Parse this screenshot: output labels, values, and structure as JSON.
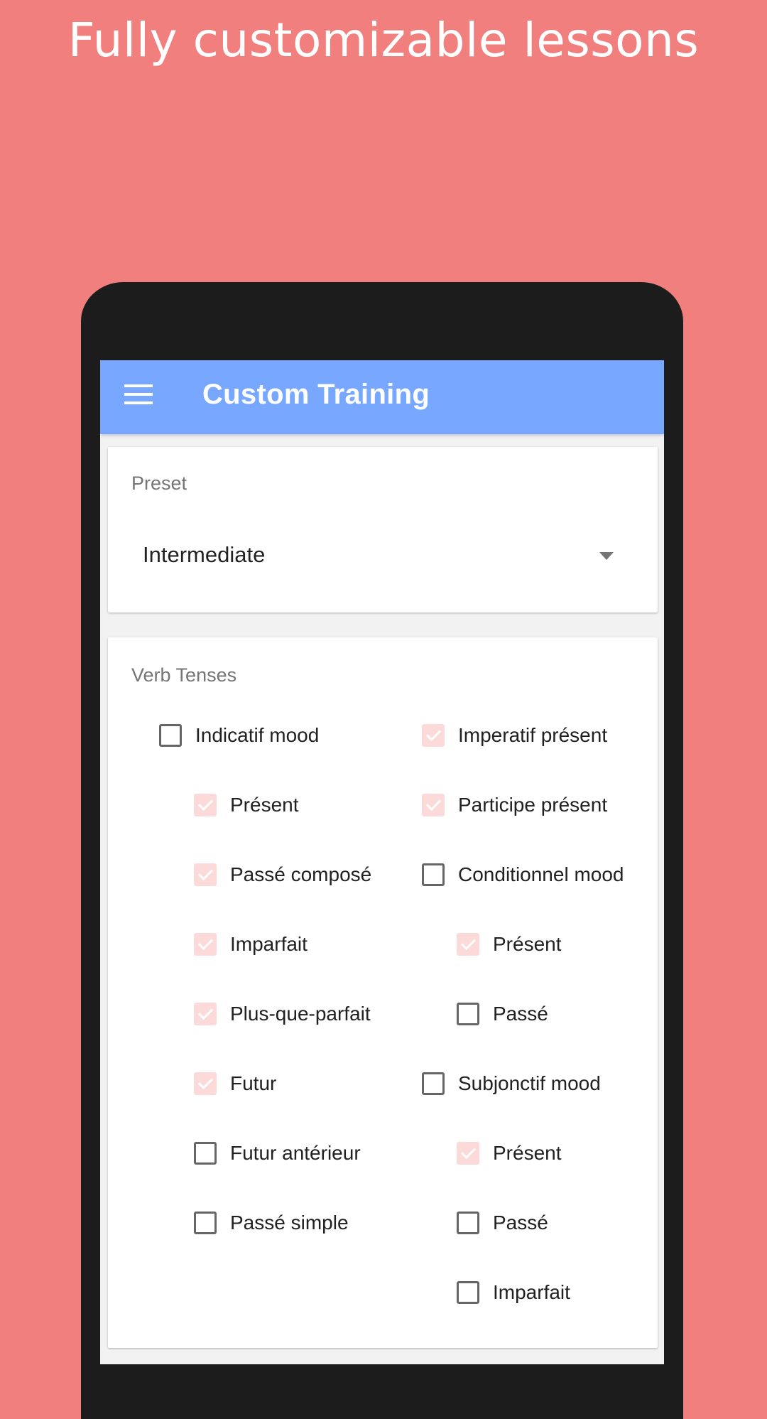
{
  "promo": {
    "title": "Fully customizable lessons"
  },
  "app_bar": {
    "title": "Custom Training",
    "menu_icon": "hamburger-menu-icon"
  },
  "preset": {
    "label": "Preset",
    "selected": "Intermediate",
    "arrow_icon": "dropdown-arrow-icon"
  },
  "tenses": {
    "label": "Verb Tenses",
    "left_column": [
      {
        "label": "Indicatif mood",
        "checked": false
      },
      {
        "label": "Présent",
        "checked": true
      },
      {
        "label": "Passé composé",
        "checked": true
      },
      {
        "label": "Imparfait",
        "checked": true
      },
      {
        "label": "Plus-que-parfait",
        "checked": true
      },
      {
        "label": "Futur",
        "checked": true
      },
      {
        "label": "Futur antérieur",
        "checked": false
      },
      {
        "label": "Passé simple",
        "checked": false
      }
    ],
    "right_column": [
      {
        "label": "Imperatif présent",
        "checked": true
      },
      {
        "label": "Participe présent",
        "checked": true
      },
      {
        "label": "Conditionnel mood",
        "checked": false
      },
      {
        "label": "Présent",
        "checked": true
      },
      {
        "label": "Passé",
        "checked": false
      },
      {
        "label": "Subjonctif mood",
        "checked": false
      },
      {
        "label": "Présent",
        "checked": true
      },
      {
        "label": "Passé",
        "checked": false
      },
      {
        "label": "Imparfait",
        "checked": false
      }
    ]
  },
  "colors": {
    "background": "#F07F7E",
    "app_bar": "#77A7FF",
    "checked_box": "#FCDAD9",
    "unchecked_border": "#666666"
  }
}
